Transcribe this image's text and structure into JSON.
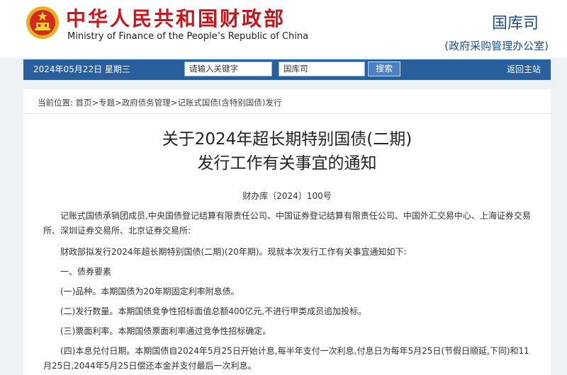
{
  "header": {
    "title_cn": "中华人民共和国财政部",
    "title_en": "Ministry of Finance of the People’s Republic of China",
    "dept": "国库司",
    "dept_sub": "(政府采购管理办公室)"
  },
  "navbar": {
    "date": "2024年05月22日  星期三",
    "search_keyword": "请输入关键字",
    "search_scope": "国库司",
    "search_button": "搜索",
    "back_link": "返回主站"
  },
  "breadcrumb": "当前位置:  首页>专题>政府债务管理>记账式国债(含特别国债)发行",
  "document": {
    "title_line1": "关于2024年超长期特别国债(二期)",
    "title_line2": "发行工作有关事宜的通知",
    "doc_number": "财办库〔2024〕100号",
    "paragraphs": [
      "记账式国债承销团成员,中央国债登记结算有限责任公司、中国证券登记结算有限责任公司、中国外汇交易中心、上海证券交易所、深圳证券交易所、北京证券交易所:",
      "财政部拟发行2024年超长期特别国债(二期)(20年期)。现就本次发行工作有关事宜通知如下:",
      "一、债券要素",
      "(一)品种。本期国债为20年期固定利率附息债。",
      "(二)发行数量。本期国债竞争性招标面值总额400亿元,不进行甲类成员追加投标。",
      "(三)票面利率。本期国债票面利率通过竞争性招标确定。",
      "(四)本息兑付日期。本期国债自2024年5月25日开始计息,每半年支付一次利息,付息日为每年5月25日(节假日顺延,下同)和11月25日,2044年5月25日偿还本金并支付最后一次利息。"
    ]
  },
  "colors": {
    "brand_red": "#c8161d",
    "nav_blue": "#2a5f9e",
    "dept_blue": "#1e4e8c"
  }
}
